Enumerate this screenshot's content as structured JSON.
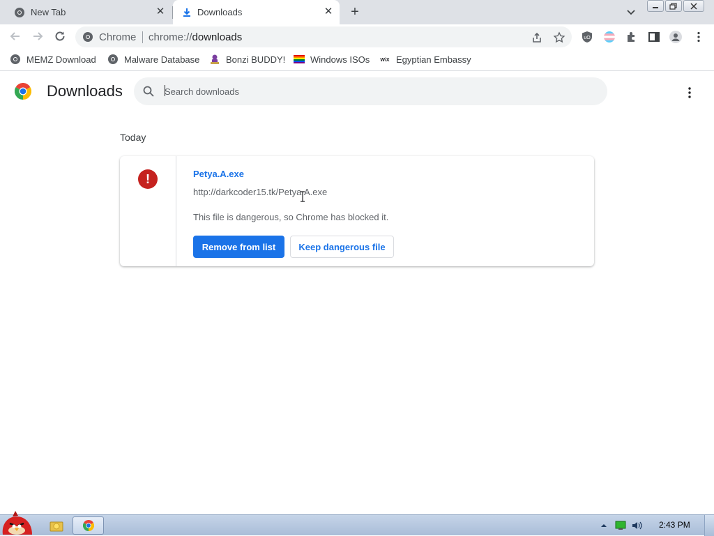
{
  "tabs": [
    {
      "title": "New Tab",
      "icon": "chrome-icon",
      "active": false
    },
    {
      "title": "Downloads",
      "icon": "download-icon",
      "active": true
    }
  ],
  "toolbar": {
    "site_chip": "Chrome",
    "url_scheme": "chrome://",
    "url_host": "downloads"
  },
  "bookmarks": [
    {
      "label": "MEMZ Download",
      "icon": "globe-icon"
    },
    {
      "label": "Malware Database",
      "icon": "globe-icon"
    },
    {
      "label": "Bonzi BUDDY!",
      "icon": "bonzi-icon"
    },
    {
      "label": "Windows ISOs",
      "icon": "rainbow-flag-icon"
    },
    {
      "label": "Egyptian Embassy",
      "icon": "wix-icon"
    }
  ],
  "page": {
    "title": "Downloads",
    "search_placeholder": "Search downloads",
    "date_heading": "Today"
  },
  "download": {
    "file_name": "Petya.A.exe",
    "url": "http://darkcoder15.tk/Petya.A.exe",
    "status": "This file is dangerous, so Chrome has blocked it.",
    "primary_action": "Remove from list",
    "secondary_action": "Keep dangerous file"
  },
  "taskbar": {
    "clock": "2:43 PM"
  },
  "colors": {
    "accent": "#1a73e8",
    "danger": "#c5221f",
    "tabstrip": "#dee1e6"
  }
}
